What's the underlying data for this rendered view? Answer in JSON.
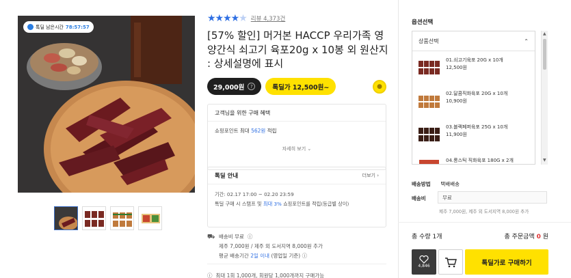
{
  "gallery": {
    "timer_label": "톡딜 남은시간",
    "timer_value": "78:57:57"
  },
  "product": {
    "rating_stars": 4,
    "review_link": "리뷰 4,373건",
    "title": "[57% 할인] 머거본 HACCP 우리가족 영양간식 쇠고기 육포20g x 10봉 외 원산지 : 상세설명에 표시",
    "price_normal": "29,000원",
    "price_deal": "톡딜가 12,500원~"
  },
  "benefit": {
    "heading": "고객님을 위한 구매 혜택",
    "line_prefix": "쇼핑포인트 최대",
    "line_points": "562원",
    "line_suffix": "적립",
    "more_label": "자세히 보기"
  },
  "deal": {
    "heading": "톡딜 안내",
    "more_label": "더보기",
    "period": "기간: 02.17 17:00 ~ 02.20 23:59",
    "desc_prefix": "톡딜 구매 시 스탬프 및",
    "desc_highlight": "최대 3%",
    "desc_suffix": "쇼핑포인트를 적립(등급별 상이)"
  },
  "shipping": {
    "fee": "배송비 무료",
    "extra": "제주 7,000원 / 제주 외 도서지역 8,000원 추가",
    "eta_prefix": "평균 배송기간",
    "eta_highlight": "2일 이내",
    "eta_suffix": "(영업일 기준)",
    "limit": "최대 1회 1,000개, 회원당 1,000개까지 구매가능"
  },
  "options": {
    "label": "옵션선택",
    "select_placeholder": "상품선택",
    "items": [
      {
        "name": "01.쇠고기육포 20G x 10개",
        "price": "12,500원"
      },
      {
        "name": "02.달콤직화육포 20G x 10개",
        "price": "10,900원"
      },
      {
        "name": "03.블랙페퍼육포 25G x 10개",
        "price": "11,900원"
      },
      {
        "name": "04.롱스틱 직화육포 180G x 2개",
        "price": ""
      }
    ]
  },
  "delivery": {
    "method_label": "배송방법",
    "method_value": "택배배송",
    "fee_label": "배송비",
    "fee_value": "무료",
    "fee_note": "제주 7,000원, 제주 외 도서지역 8,000원 추가"
  },
  "totals": {
    "qty_label": "총 수량 1개",
    "amount_label": "총 주문금액",
    "amount_value": "0",
    "amount_unit": "원"
  },
  "actions": {
    "wish_count": "4,846",
    "buy_label": "톡딜가로 구매하기"
  },
  "colors": {
    "accent_blue": "#2f6fe3",
    "deal_yellow": "#ffe100",
    "total_red": "#e03333"
  }
}
